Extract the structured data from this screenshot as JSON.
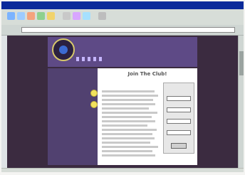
{
  "page": {
    "heading": "Join The Club!"
  }
}
